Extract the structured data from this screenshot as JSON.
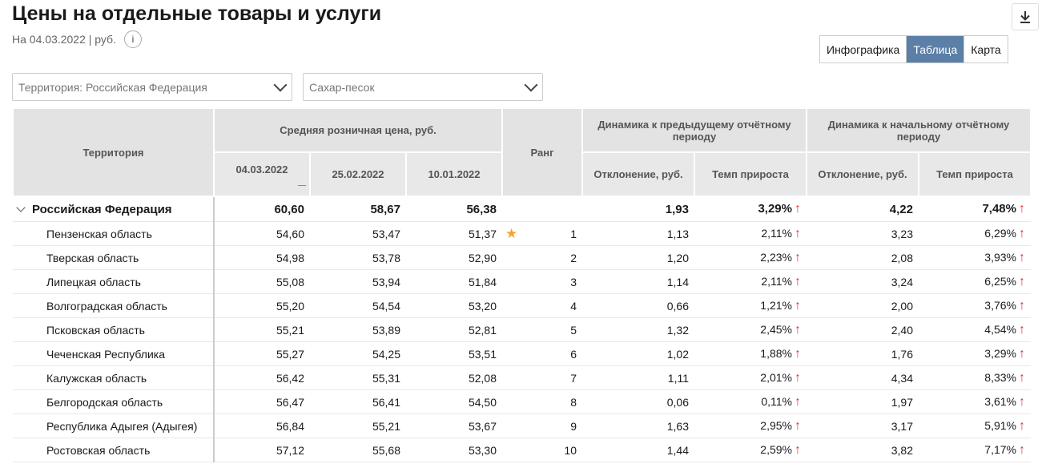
{
  "page": {
    "title": "Цены на отдельные товары и услуги",
    "subtitle": "На 04.03.2022 | руб."
  },
  "icons": {
    "info": "i",
    "download": "download-icon"
  },
  "view_switch": {
    "options": [
      "Инфографика",
      "Таблица",
      "Карта"
    ],
    "active": "Таблица",
    "active_color": "#5b7fa6"
  },
  "filters": {
    "territory": "Территория: Российская  Федерация",
    "product": "Сахар-песок"
  },
  "table": {
    "headers": {
      "territory": "Территория",
      "avg_price": "Средняя розничная цена, руб.",
      "rank": "Ранг",
      "prev_period": "Динамика к предыдущему отчётному периоду",
      "start_period": "Динамика к начальному отчётному периоду",
      "dates": [
        "04.03.2022",
        "25.02.2022",
        "10.01.2022"
      ],
      "deviation": "Отклонение, руб.",
      "growth": "Темп прироста"
    },
    "total": {
      "name": "Российская Федерация",
      "p1": "60,60",
      "p2": "58,67",
      "p3": "56,38",
      "dev1": "1,93",
      "gr1": "3,29%",
      "dev2": "4,22",
      "gr2": "7,48%"
    },
    "rows": [
      {
        "name": "Пензенская область",
        "p1": "54,60",
        "p2": "53,47",
        "p3": "51,37",
        "rank": "1",
        "star": true,
        "dev1": "1,13",
        "gr1": "2,11%",
        "dev2": "3,23",
        "gr2": "6,29%"
      },
      {
        "name": "Тверская область",
        "p1": "54,98",
        "p2": "53,78",
        "p3": "52,90",
        "rank": "2",
        "dev1": "1,20",
        "gr1": "2,23%",
        "dev2": "2,08",
        "gr2": "3,93%"
      },
      {
        "name": "Липецкая область",
        "p1": "55,08",
        "p2": "53,94",
        "p3": "51,84",
        "rank": "3",
        "dev1": "1,14",
        "gr1": "2,11%",
        "dev2": "3,24",
        "gr2": "6,25%"
      },
      {
        "name": "Волгоградская область",
        "p1": "55,20",
        "p2": "54,54",
        "p3": "53,20",
        "rank": "4",
        "dev1": "0,66",
        "gr1": "1,21%",
        "dev2": "2,00",
        "gr2": "3,76%"
      },
      {
        "name": "Псковская область",
        "p1": "55,21",
        "p2": "53,89",
        "p3": "52,81",
        "rank": "5",
        "dev1": "1,32",
        "gr1": "2,45%",
        "dev2": "2,40",
        "gr2": "4,54%"
      },
      {
        "name": "Чеченская Республика",
        "p1": "55,27",
        "p2": "54,25",
        "p3": "53,51",
        "rank": "6",
        "dev1": "1,02",
        "gr1": "1,88%",
        "dev2": "1,76",
        "gr2": "3,29%"
      },
      {
        "name": "Калужская область",
        "p1": "56,42",
        "p2": "55,31",
        "p3": "52,08",
        "rank": "7",
        "dev1": "1,11",
        "gr1": "2,01%",
        "dev2": "4,34",
        "gr2": "8,33%"
      },
      {
        "name": "Белгородская область",
        "p1": "56,47",
        "p2": "56,41",
        "p3": "54,50",
        "rank": "8",
        "dev1": "0,06",
        "gr1": "0,11%",
        "dev2": "1,97",
        "gr2": "3,61%"
      },
      {
        "name": "Республика Адыгея (Адыгея)",
        "p1": "56,84",
        "p2": "55,21",
        "p3": "53,67",
        "rank": "9",
        "dev1": "1,63",
        "gr1": "2,95%",
        "dev2": "3,17",
        "gr2": "5,91%"
      },
      {
        "name": "Ростовская область",
        "p1": "57,12",
        "p2": "55,68",
        "p3": "53,30",
        "rank": "10",
        "dev1": "1,44",
        "gr1": "2,59%",
        "dev2": "3,82",
        "gr2": "7,17%"
      }
    ]
  }
}
